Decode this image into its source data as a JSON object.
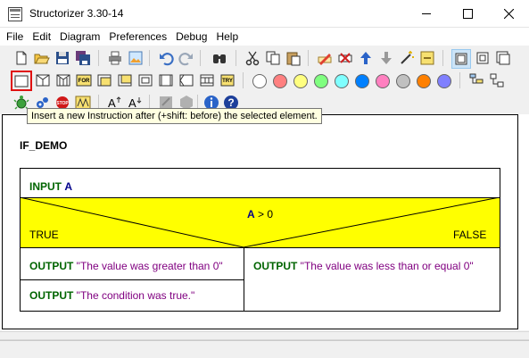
{
  "window": {
    "title": "Structorizer 3.30-14"
  },
  "menu": [
    "File",
    "Edit",
    "Diagram",
    "Preferences",
    "Debug",
    "Help"
  ],
  "toolbar": {
    "for_label": "FOR",
    "while_label": "WHILE",
    "try_label": "TRY",
    "colors": [
      "#ffffff",
      "#ff8080",
      "#ffff80",
      "#80ff80",
      "#80ffff",
      "#0080ff",
      "#ff80c0",
      "#c0c0c0",
      "#ff8000",
      "#8080ff"
    ]
  },
  "tooltip": "Insert a new Instruction after (+shift: before) the selected element.",
  "diagram": {
    "name": "IF_DEMO",
    "input": {
      "keyword": "INPUT",
      "var": "A"
    },
    "alternative": {
      "condition_var": "A",
      "condition_rest": " > 0",
      "true_label": "TRUE",
      "false_label": "FALSE"
    },
    "true_branch": [
      {
        "keyword": "OUTPUT",
        "text": " \"The value was greater than 0\""
      },
      {
        "keyword": "OUTPUT",
        "text": " \"The condition was true.\""
      }
    ],
    "false_branch": [
      {
        "keyword": "OUTPUT",
        "text": " \"The value was less than or equal 0\""
      }
    ]
  }
}
